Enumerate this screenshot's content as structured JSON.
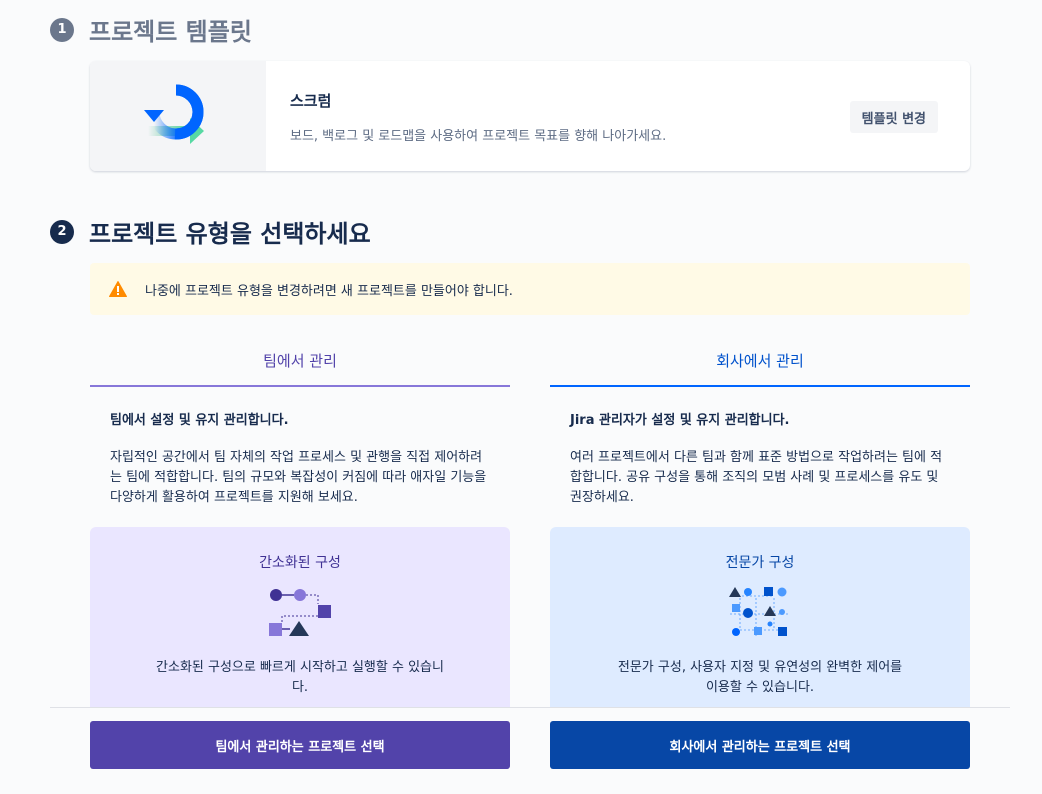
{
  "step1": {
    "number": "1",
    "title": "프로젝트 템플릿"
  },
  "template": {
    "name": "스크럼",
    "description": "보드, 백로그 및 로드맵을 사용하여 프로젝트 목표를 향해 나아가세요.",
    "change_label": "템플릿 변경",
    "icon": "scrum-cycle-icon"
  },
  "step2": {
    "number": "2",
    "title": "프로젝트 유형을 선택하세요"
  },
  "warning": {
    "icon": "warning-icon",
    "text": "나중에 프로젝트 유형을 변경하려면 새 프로젝트를 만들어야 합니다."
  },
  "team_managed": {
    "tab_label": "팀에서 관리",
    "heading": "팀에서 설정 및 유지 관리합니다.",
    "body": "자립적인 공간에서 팀 자체의 작업 프로세스 및 관행을 직접 제어하려는 팀에 적합합니다. 팀의 규모와 복잡성이 커짐에 따라 애자일 기능을 다양하게 활용하여 프로젝트를 지원해 보세요.",
    "config_title": "간소화된 구성",
    "config_desc": "간소화된 구성으로 빠르게 시작하고 실행할 수 있습니다.",
    "select_label": "팀에서 관리하는 프로젝트 선택",
    "color": "#5243aa"
  },
  "company_managed": {
    "tab_label": "회사에서 관리",
    "heading": "Jira 관리자가 설정 및 유지 관리합니다.",
    "body": "여러 프로젝트에서 다른 팀과 함께 표준 방법으로 작업하려는 팀에 적합합니다. 공유 구성을 통해 조직의 모범 사례 및 프로세스를 유도 및 권장하세요.",
    "config_title": "전문가 구성",
    "config_desc": "전문가 구성, 사용자 지정 및 유연성의 완벽한 제어를 이용할 수 있습니다.",
    "select_label": "회사에서 관리하는 프로젝트 선택",
    "color": "#0747a6"
  }
}
